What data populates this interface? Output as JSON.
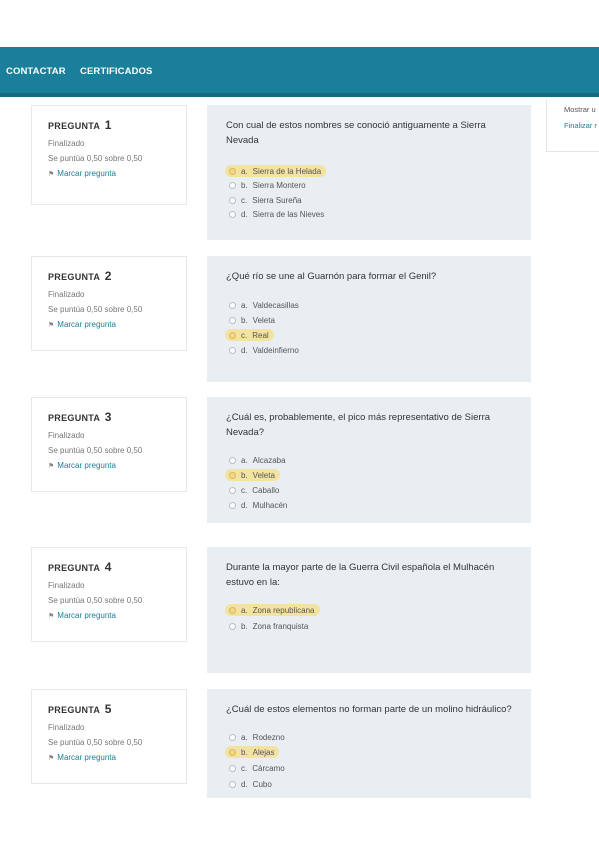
{
  "nav": {
    "contact": "CONTACTAR",
    "certificates": "CERTIFICADOS"
  },
  "side": {
    "line1": "Mostrar u",
    "line2": "Finalizar r"
  },
  "questions": [
    {
      "label": "PREGUNTA",
      "number": "1",
      "state": "Finalizado",
      "grade": "Se puntúa 0,50 sobre 0,50",
      "flag": "Marcar pregunta",
      "text": "Con cual de estos nombres se conoció antiguamente a Sierra Nevada",
      "answers": [
        {
          "letter": "a.",
          "text": "Sierra de la Helada",
          "selected": true
        },
        {
          "letter": "b.",
          "text": "Sierra Montero",
          "selected": false
        },
        {
          "letter": "c.",
          "text": "Sierra Sureña",
          "selected": false
        },
        {
          "letter": "d.",
          "text": "Sierra de las Nieves",
          "selected": false
        }
      ]
    },
    {
      "label": "PREGUNTA",
      "number": "2",
      "state": "Finalizado",
      "grade": "Se puntúa 0,50 sobre 0,50",
      "flag": "Marcar pregunta",
      "text": "¿Qué río se une al Guarnón para formar el Genil?",
      "answers": [
        {
          "letter": "a.",
          "text": "Valdecasillas",
          "selected": false
        },
        {
          "letter": "b.",
          "text": "Veleta",
          "selected": false
        },
        {
          "letter": "c.",
          "text": "Real",
          "selected": true
        },
        {
          "letter": "d.",
          "text": "Valdeinfierno",
          "selected": false
        }
      ]
    },
    {
      "label": "PREGUNTA",
      "number": "3",
      "state": "Finalizado",
      "grade": "Se puntúa 0,50 sobre 0,50",
      "flag": "Marcar pregunta",
      "text": "¿Cuál es, probablemente, el pico más representativo de Sierra Nevada?",
      "answers": [
        {
          "letter": "a.",
          "text": "Alcazaba",
          "selected": false
        },
        {
          "letter": "b.",
          "text": "Veleta",
          "selected": true
        },
        {
          "letter": "c.",
          "text": "Caballo",
          "selected": false
        },
        {
          "letter": "d.",
          "text": "Mulhacén",
          "selected": false
        }
      ]
    },
    {
      "label": "PREGUNTA",
      "number": "4",
      "state": "Finalizado",
      "grade": "Se puntúa 0,50 sobre 0,50",
      "flag": "Marcar pregunta",
      "text": "Durante la mayor parte de la Guerra Civil española el Mulhacén estuvo en la:",
      "answers": [
        {
          "letter": "a.",
          "text": "Zona republicana",
          "selected": true
        },
        {
          "letter": "b.",
          "text": "Zona franquista",
          "selected": false
        }
      ]
    },
    {
      "label": "PREGUNTA",
      "number": "5",
      "state": "Finalizado",
      "grade": "Se puntúa 0,50 sobre 0,50",
      "flag": "Marcar pregunta",
      "text": "¿Cuál de estos elementos no forman parte de un molino hidráulico?",
      "answers": [
        {
          "letter": "a.",
          "text": "Rodezno",
          "selected": false
        },
        {
          "letter": "b.",
          "text": "Alejas",
          "selected": true
        },
        {
          "letter": "c.",
          "text": "Cárcamo",
          "selected": false
        },
        {
          "letter": "d.",
          "text": "Cubo",
          "selected": false
        }
      ]
    }
  ]
}
